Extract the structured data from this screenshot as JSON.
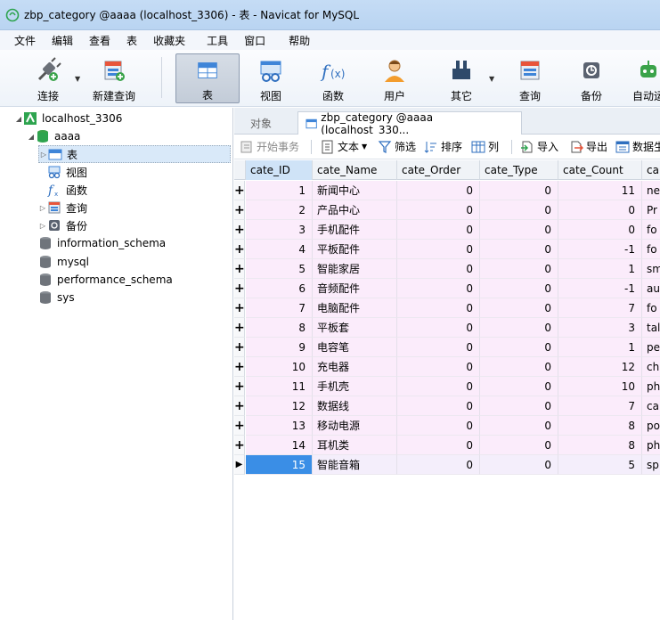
{
  "window": {
    "title": "zbp_category @aaaa (localhost_3306) - 表 - Navicat for MySQL"
  },
  "menu": [
    "文件",
    "编辑",
    "查看",
    "表",
    "收藏夹",
    "工具",
    "窗口",
    "帮助"
  ],
  "toolbar": {
    "connect": "连接",
    "new_query": "新建查询",
    "table": "表",
    "view": "视图",
    "function": "函数",
    "user": "用户",
    "other": "其它",
    "query": "查询",
    "backup": "备份",
    "schedule": "自动运"
  },
  "tree": {
    "connection": "localhost_3306",
    "database": "aaaa",
    "items": [
      "表",
      "视图",
      "函数",
      "查询",
      "备份"
    ],
    "other_databases": [
      "information_schema",
      "mysql",
      "performance_schema",
      "sys"
    ]
  },
  "tabs": {
    "objects": "对象",
    "active": "zbp_category @aaaa (localhost_330..."
  },
  "subtoolbar": {
    "begin_transaction": "开始事务",
    "text": "文本",
    "filter": "筛选",
    "sort": "排序",
    "columns": "列",
    "import": "导入",
    "export": "导出",
    "data": "数据生"
  },
  "grid": {
    "columns": [
      "cate_ID",
      "cate_Name",
      "cate_Order",
      "cate_Type",
      "cate_Count",
      "ca"
    ],
    "rows": [
      [
        "1",
        "新闻中心",
        "0",
        "0",
        "11",
        "ne"
      ],
      [
        "2",
        "产品中心",
        "0",
        "0",
        "0",
        "Pr"
      ],
      [
        "3",
        "手机配件",
        "0",
        "0",
        "0",
        "fo"
      ],
      [
        "4",
        "平板配件",
        "0",
        "0",
        "-1",
        "fo"
      ],
      [
        "5",
        "智能家居",
        "0",
        "0",
        "1",
        "sm"
      ],
      [
        "6",
        "音频配件",
        "0",
        "0",
        "-1",
        "au"
      ],
      [
        "7",
        "电脑配件",
        "0",
        "0",
        "7",
        "fo"
      ],
      [
        "8",
        "平板套",
        "0",
        "0",
        "3",
        "tal"
      ],
      [
        "9",
        "电容笔",
        "0",
        "0",
        "1",
        "pe"
      ],
      [
        "10",
        "充电器",
        "0",
        "0",
        "12",
        "ch"
      ],
      [
        "11",
        "手机壳",
        "0",
        "0",
        "10",
        "ph"
      ],
      [
        "12",
        "数据线",
        "0",
        "0",
        "7",
        "ca"
      ],
      [
        "13",
        "移动电源",
        "0",
        "0",
        "8",
        "po"
      ],
      [
        "14",
        "耳机类",
        "0",
        "0",
        "8",
        "ph"
      ],
      [
        "15",
        "智能音箱",
        "0",
        "0",
        "5",
        "sp"
      ]
    ],
    "selected_row": 14
  },
  "colors": {
    "row_bg": "#fbecfb",
    "selection": "#3a8ee6",
    "title_bar": "#c5dcf5"
  }
}
